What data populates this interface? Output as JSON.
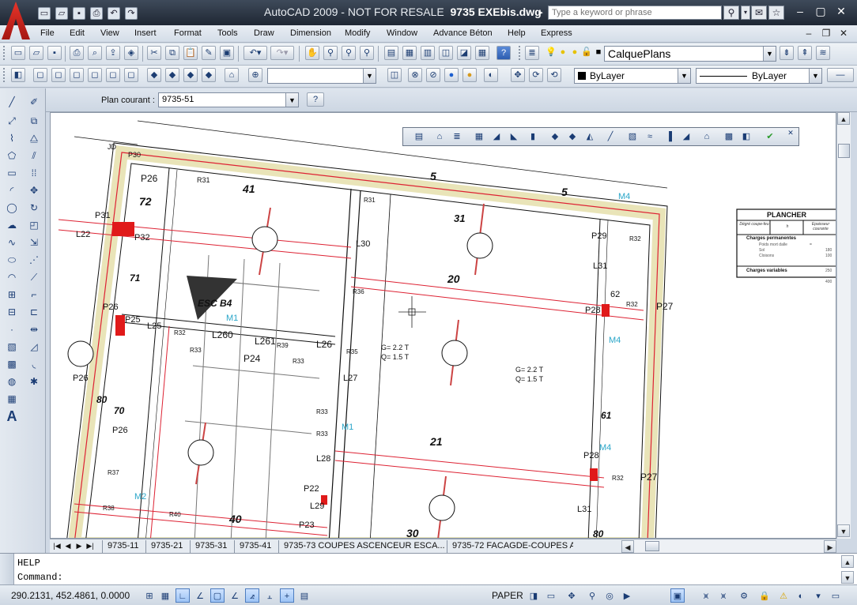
{
  "window": {
    "title_prefix": "AutoCAD 2009 - NOT FOR RESALE",
    "title_file": "9735 EXEbis.dwg",
    "search_placeholder": "Type a keyword or phrase"
  },
  "menubar": {
    "items": [
      "File",
      "Edit",
      "View",
      "Insert",
      "Format",
      "Tools",
      "Draw",
      "Dimension",
      "Modify",
      "Window",
      "Advance Béton",
      "Help",
      "Express"
    ]
  },
  "toolbars": {
    "layer_combo": "CalquePlans",
    "color_combo": "ByLayer",
    "linetype_combo": "ByLayer",
    "plan_label": "Plan courant :",
    "plan_value": "9735-51"
  },
  "drawing": {
    "texts": [
      {
        "t": "JD"
      },
      {
        "t": "P30"
      },
      {
        "t": "P26"
      },
      {
        "t": "72"
      },
      {
        "t": "R31"
      },
      {
        "t": "41"
      },
      {
        "t": "5"
      },
      {
        "t": "5"
      },
      {
        "t": "M4"
      },
      {
        "t": "P31"
      },
      {
        "t": "P32"
      },
      {
        "t": "L22"
      },
      {
        "t": "31"
      },
      {
        "t": "P29"
      },
      {
        "t": "R32"
      },
      {
        "t": "L30"
      },
      {
        "t": "R31"
      },
      {
        "t": "L31"
      },
      {
        "t": "71"
      },
      {
        "t": "20"
      },
      {
        "t": "62"
      },
      {
        "t": "P26"
      },
      {
        "t": "P25"
      },
      {
        "t": "L25"
      },
      {
        "t": "ESC B4"
      },
      {
        "t": "R36"
      },
      {
        "t": "M1"
      },
      {
        "t": "P28"
      },
      {
        "t": "R32"
      },
      {
        "t": "P27"
      },
      {
        "t": "L260"
      },
      {
        "t": "L261"
      },
      {
        "t": "L26"
      },
      {
        "t": "R32"
      },
      {
        "t": "R33"
      },
      {
        "t": "R39"
      },
      {
        "t": "R35"
      },
      {
        "t": "P24"
      },
      {
        "t": "R33"
      },
      {
        "t": "M4"
      },
      {
        "t": "G= 2.2 T"
      },
      {
        "t": "Q= 1.5 T"
      },
      {
        "t": "G= 2.2 T"
      },
      {
        "t": "Q= 1.5 T"
      },
      {
        "t": "P26"
      },
      {
        "t": "80"
      },
      {
        "t": "70"
      },
      {
        "t": "L27"
      },
      {
        "t": "R33"
      },
      {
        "t": "P26"
      },
      {
        "t": "R33"
      },
      {
        "t": "M1"
      },
      {
        "t": "21"
      },
      {
        "t": "61"
      },
      {
        "t": "L28"
      },
      {
        "t": "M4"
      },
      {
        "t": "P28"
      },
      {
        "t": "R32"
      },
      {
        "t": "P27"
      },
      {
        "t": "R37"
      },
      {
        "t": "P22"
      },
      {
        "t": "L31"
      },
      {
        "t": "M2"
      },
      {
        "t": "R38"
      },
      {
        "t": "L29"
      },
      {
        "t": "R40"
      },
      {
        "t": "40"
      },
      {
        "t": "P23"
      },
      {
        "t": "30"
      },
      {
        "t": "80"
      }
    ],
    "plancher": {
      "title": "PLANCHER",
      "col1": "Dégré coupe-feu",
      "col2": "h",
      "col3": "Epaisseur courante",
      "perm": "Charges permanentes",
      "rows": [
        {
          "label": "Poids mort dalle",
          "value": "="
        },
        {
          "label": "Sol",
          "value": "180"
        },
        {
          "label": "Cloisons",
          "value": "100"
        }
      ],
      "var": "Charges variables",
      "var_value": "250",
      "total": "400"
    }
  },
  "layout_tabs": [
    "9735-11",
    "9735-21",
    "9735-31",
    "9735-41",
    "9735-73 COUPES ASCENCEUR ESCA...",
    "9735-72 FACAGDE-COUPES A"
  ],
  "command_line": {
    "history": "HELP",
    "prompt": "Command:"
  },
  "statusbar": {
    "coords": "290.2131, 452.4861, 0.0000",
    "paper": "PAPER"
  }
}
